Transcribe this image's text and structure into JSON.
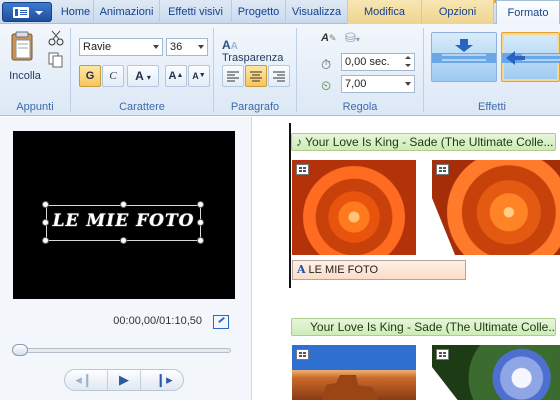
{
  "tabs": {
    "items": [
      "Home",
      "Animazioni",
      "Effetti visivi",
      "Progetto",
      "Visualizza",
      "Modifica",
      "Opzioni",
      "Formato"
    ],
    "active": "Formato"
  },
  "ribbon": {
    "clipboard": {
      "paste_label": "Incolla",
      "group_label": "Appunti"
    },
    "font": {
      "family": "Ravie",
      "size": "36",
      "bold": "G",
      "italic": "C",
      "color_glyph": "A",
      "grow_glyph": "A",
      "shrink_glyph": "A",
      "group_label": "Carattere"
    },
    "paragraph": {
      "transparency_label": "Trasparenza",
      "group_label": "Paragrafo"
    },
    "adjust": {
      "start_time": "0,00 sec.",
      "duration": "7,00",
      "group_label": "Regola"
    },
    "effects": {
      "group_label": "Effetti"
    }
  },
  "preview": {
    "overlay_text": "LE MIE FOTO",
    "time": "00:00,00/01:10,50"
  },
  "storyboard": {
    "audio_tracks": [
      "Your Love Is King - Sade (The Ultimate Colle...",
      "Your Love Is King - Sade (The Ultimate Colle..."
    ],
    "caption": "LE MIE FOTO",
    "caption_icon": "A"
  },
  "colors": {
    "accent": "#e8a22a",
    "ribbon_bg": "#dce8f6",
    "audio_green": "#cfeab8",
    "caption_peach": "#fbdcc8"
  }
}
